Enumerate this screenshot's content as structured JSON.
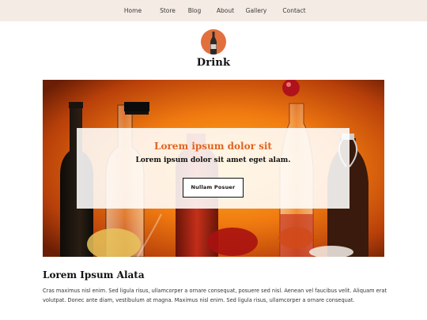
{
  "nav": {
    "items": [
      {
        "label": "Home"
      },
      {
        "label": "Store"
      },
      {
        "label": "Blog"
      },
      {
        "label": "About"
      },
      {
        "label": "Gallery"
      },
      {
        "label": "Contact"
      }
    ]
  },
  "site": {
    "logo_icon": "wine-bottle-icon",
    "title": "Drink"
  },
  "hero": {
    "headline": "Lorem ipsum dolor sit",
    "subheadline": "Lorem ipsum dolor sit amet eget alam.",
    "button_label": "Nullam Posuer"
  },
  "main": {
    "heading": "Lorem Ipsum Alata",
    "paragraph": "Cras maximus nisl enim. Sed ligula risus, ullamcorper a ornare consequat, posuere sed nisl. Aenean vel faucibus velit. Aliquam erat volutpat. Donec ante diam, vestibulum at magna. Maximus nisl enim. Sed ligula risus, ullamcorper a ornare consequat."
  },
  "colors": {
    "nav_background": "#f4ebe5",
    "accent": "#e2631f",
    "logo_circle": "#e2703c"
  }
}
